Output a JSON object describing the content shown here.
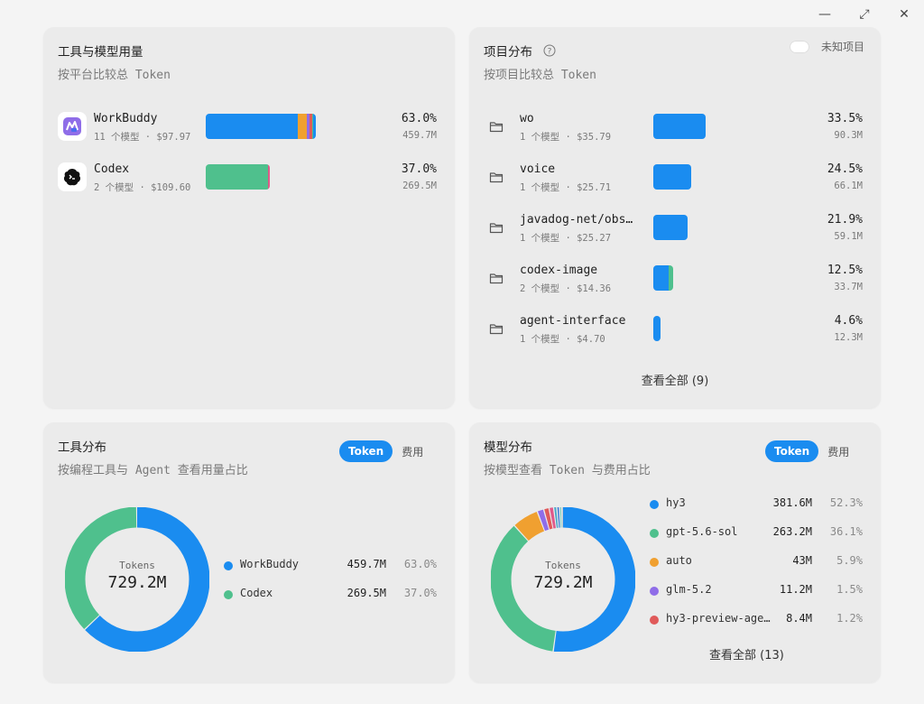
{
  "window": {
    "minimize_glyph": "—",
    "maximize_glyph": "⤢",
    "close_glyph": "✕"
  },
  "tool_usage": {
    "title": "工具与模型用量",
    "subtitle": "按平台比较总 Token",
    "rows": [
      {
        "name": "WorkBuddy",
        "meta": "11 个模型 · $97.97",
        "pct": "63.0%",
        "amount": "459.7M",
        "bar_fraction": 0.63,
        "segments": [
          {
            "color": "#1a8cf0",
            "fraction": 0.835
          },
          {
            "color": "#f0a030",
            "fraction": 0.09
          },
          {
            "color": "#8f6de8",
            "fraction": 0.025
          },
          {
            "color": "#e05a5a",
            "fraction": 0.02
          },
          {
            "color": "#4fc08d",
            "fraction": 0.01
          },
          {
            "color": "#1a8cf0",
            "fraction": 0.02
          }
        ]
      },
      {
        "name": "Codex",
        "meta": "2 个模型 · $109.60",
        "pct": "37.0%",
        "amount": "269.5M",
        "bar_fraction": 0.37,
        "segments": [
          {
            "color": "#4fc08d",
            "fraction": 0.97
          },
          {
            "color": "#e05a8a",
            "fraction": 0.03
          }
        ]
      }
    ]
  },
  "project_distribution": {
    "title": "项目分布",
    "help_icon": "question-circle-icon",
    "toggle_label": "未知项目",
    "subtitle": "按项目比较总 Token",
    "rows": [
      {
        "name": "wo",
        "meta": "1 个模型 · $35.79",
        "pct": "33.5%",
        "amount": "90.3M",
        "bar_fraction": 0.335,
        "segments": [
          {
            "color": "#1a8cf0",
            "fraction": 1
          }
        ]
      },
      {
        "name": "voice",
        "meta": "1 个模型 · $25.71",
        "pct": "24.5%",
        "amount": "66.1M",
        "bar_fraction": 0.245,
        "segments": [
          {
            "color": "#1a8cf0",
            "fraction": 1
          }
        ]
      },
      {
        "name": "javadog-net/obs…",
        "meta": "1 个模型 · $25.27",
        "pct": "21.9%",
        "amount": "59.1M",
        "bar_fraction": 0.219,
        "segments": [
          {
            "color": "#1a8cf0",
            "fraction": 1
          }
        ]
      },
      {
        "name": "codex-image",
        "meta": "2 个模型 · $14.36",
        "pct": "12.5%",
        "amount": "33.7M",
        "bar_fraction": 0.125,
        "segments": [
          {
            "color": "#1a8cf0",
            "fraction": 0.8
          },
          {
            "color": "#4fc08d",
            "fraction": 0.2
          }
        ]
      },
      {
        "name": "agent-interface",
        "meta": "1 个模型 · $4.70",
        "pct": "4.6%",
        "amount": "12.3M",
        "bar_fraction": 0.046,
        "segments": [
          {
            "color": "#1a8cf0",
            "fraction": 1
          }
        ]
      }
    ],
    "view_all": "查看全部 (9)"
  },
  "tool_distribution": {
    "title": "工具分布",
    "subtitle": "按编程工具与 Agent 查看用量占比",
    "seg_token": "Token",
    "seg_cost": "费用",
    "center_label": "Tokens",
    "center_value": "729.2M",
    "legend": [
      {
        "name": "WorkBuddy",
        "value": "459.7M",
        "pct": "63.0%",
        "color": "#1a8cf0",
        "share": 0.63
      },
      {
        "name": "Codex",
        "value": "269.5M",
        "pct": "37.0%",
        "color": "#4fc08d",
        "share": 0.37
      }
    ]
  },
  "model_distribution": {
    "title": "模型分布",
    "subtitle": "按模型查看 Token 与费用占比",
    "seg_token": "Token",
    "seg_cost": "费用",
    "center_label": "Tokens",
    "center_value": "729.2M",
    "legend": [
      {
        "name": "hy3",
        "value": "381.6M",
        "pct": "52.3%",
        "color": "#1a8cf0",
        "share": 0.523
      },
      {
        "name": "gpt-5.6-sol",
        "value": "263.2M",
        "pct": "36.1%",
        "color": "#4fc08d",
        "share": 0.361
      },
      {
        "name": "auto",
        "value": "43M",
        "pct": "5.9%",
        "color": "#f0a030",
        "share": 0.059
      },
      {
        "name": "glm-5.2",
        "value": "11.2M",
        "pct": "1.5%",
        "color": "#8f6de8",
        "share": 0.015
      },
      {
        "name": "hy3-preview-age…",
        "value": "8.4M",
        "pct": "1.2%",
        "color": "#e05a5a",
        "share": 0.012
      }
    ],
    "extra_slices": [
      {
        "color": "#e05a8a",
        "share": 0.01
      },
      {
        "color": "#4aa8c8",
        "share": 0.007
      },
      {
        "color": "#3c7bd8",
        "share": 0.006
      },
      {
        "color": "#6fc7b8",
        "share": 0.005
      },
      {
        "color": "#9aa6b8",
        "share": 0.002
      }
    ],
    "view_all": "查看全部 (13)"
  }
}
